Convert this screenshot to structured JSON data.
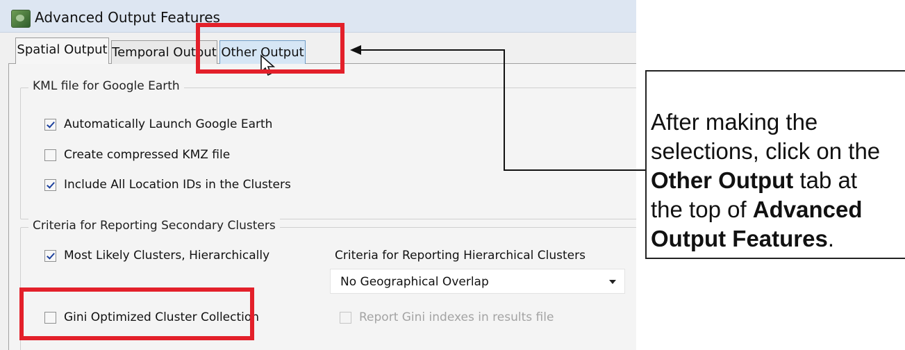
{
  "window": {
    "title": "Advanced Output Features"
  },
  "tabs": [
    {
      "label": "Spatial Output"
    },
    {
      "label": "Temporal Output"
    },
    {
      "label": "Other Output"
    }
  ],
  "kml_group": {
    "legend": "KML file for Google Earth",
    "options": [
      {
        "label": "Automatically Launch Google Earth",
        "checked": true
      },
      {
        "label": "Create compressed KMZ file",
        "checked": false
      },
      {
        "label": "Include All Location IDs in the Clusters",
        "checked": true
      }
    ]
  },
  "criteria_group": {
    "legend": "Criteria for Reporting Secondary Clusters",
    "most_likely": {
      "label": "Most Likely Clusters, Hierarchically",
      "checked": true
    },
    "hierarchical_label": "Criteria for Reporting Hierarchical Clusters",
    "hierarchical_select": {
      "value": "No Geographical Overlap"
    },
    "gini": {
      "label": "Gini Optimized Cluster Collection",
      "checked": false
    },
    "report_gini": {
      "label": "Report Gini indexes in results file",
      "checked": false,
      "disabled": true
    }
  },
  "callout": {
    "line1": "After making the",
    "line2": "selections, click on the",
    "bold1": "Other Output",
    "line3_rest": " tab at",
    "line4": "the top of ",
    "bold2": "Advanced",
    "bold3": "Output Features",
    "end": "."
  },
  "colors": {
    "highlight": "#e3202a",
    "check": "#1b3f9c"
  },
  "icons": {
    "app": "app-globe-icon",
    "cursor": "mouse-pointer-icon"
  }
}
